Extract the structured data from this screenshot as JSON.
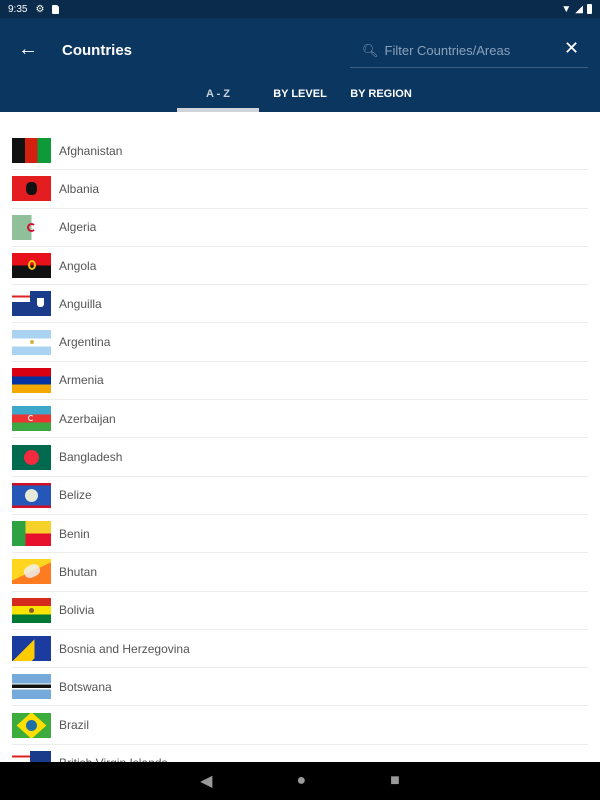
{
  "status_bar": {
    "time": "9:35",
    "icons": [
      "settings-icon",
      "sd-card-icon"
    ],
    "right_icons": [
      "wifi-icon",
      "signal-icon",
      "battery-icon"
    ]
  },
  "app_bar": {
    "back_icon": "arrow-left-icon",
    "title": "Countries",
    "search": {
      "placeholder": "Filter Countries/Areas",
      "value": ""
    },
    "close_icon": "close-icon"
  },
  "tabs": [
    {
      "label": "A - Z",
      "active": true
    },
    {
      "label": "BY LEVEL",
      "active": false
    },
    {
      "label": "BY REGION",
      "active": false
    }
  ],
  "countries": [
    {
      "name": "Afghanistan"
    },
    {
      "name": "Albania"
    },
    {
      "name": "Algeria"
    },
    {
      "name": "Angola"
    },
    {
      "name": "Anguilla"
    },
    {
      "name": "Argentina"
    },
    {
      "name": "Armenia"
    },
    {
      "name": "Azerbaijan"
    },
    {
      "name": "Bangladesh"
    },
    {
      "name": "Belize"
    },
    {
      "name": "Benin"
    },
    {
      "name": "Bhutan"
    },
    {
      "name": "Bolivia"
    },
    {
      "name": "Bosnia and Herzegovina"
    },
    {
      "name": "Botswana"
    },
    {
      "name": "Brazil"
    },
    {
      "name": "British Virgin Islands"
    }
  ],
  "nav_bar": {
    "back": "◀",
    "home": "●",
    "recents": "■"
  }
}
